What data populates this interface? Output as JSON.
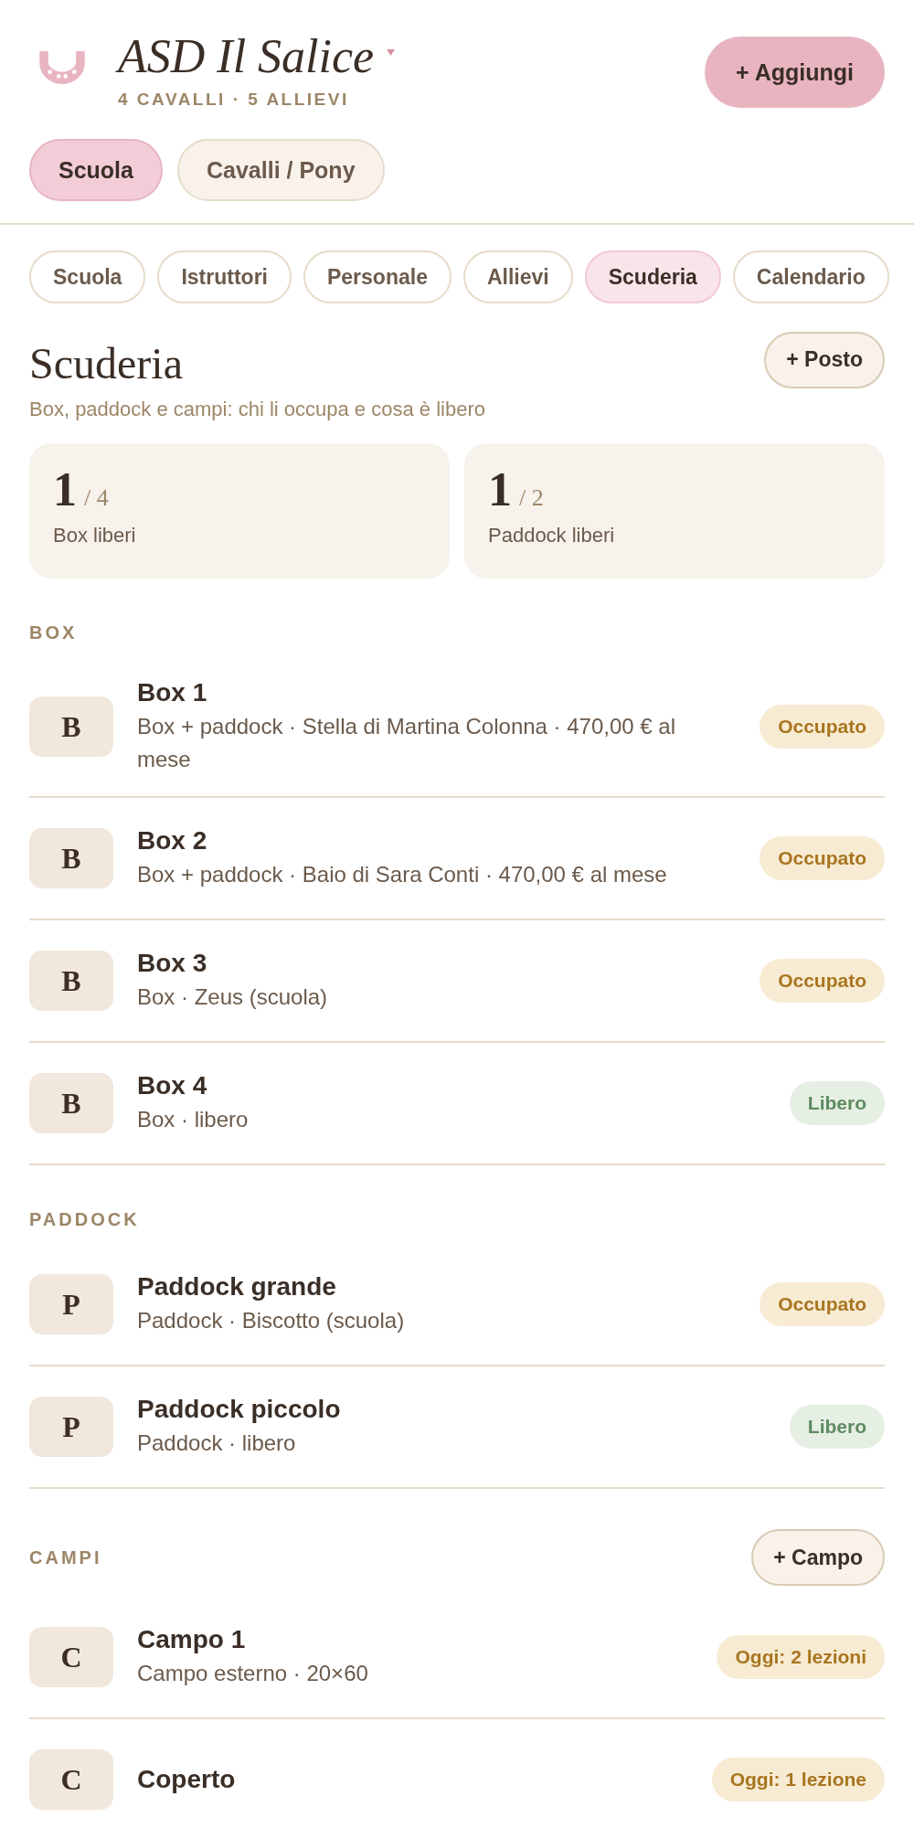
{
  "header": {
    "title": "ASD Il Salice",
    "subtitle": "4 CAVALLI · 5 ALLIEVI",
    "add_button": "+ Aggiungi"
  },
  "mode_tabs": [
    {
      "label": "Scuola",
      "selected": true
    },
    {
      "label": "Cavalli / Pony",
      "selected": false
    }
  ],
  "section_tabs": [
    {
      "label": "Scuola",
      "selected": false
    },
    {
      "label": "Istruttori",
      "selected": false
    },
    {
      "label": "Personale",
      "selected": false
    },
    {
      "label": "Allievi",
      "selected": false
    },
    {
      "label": "Scuderia",
      "selected": true
    },
    {
      "label": "Calendario",
      "selected": false
    }
  ],
  "page": {
    "title": "Scuderia",
    "subtitle": "Box, paddock e campi: chi li occupa e cosa è libero",
    "add_button": "+ Posto"
  },
  "stats": [
    {
      "value": "1",
      "total": "/ 4",
      "label": "Box liberi"
    },
    {
      "value": "1",
      "total": "/ 2",
      "label": "Paddock liberi"
    }
  ],
  "groups": [
    {
      "title": "BOX",
      "items": [
        {
          "initial": "B",
          "name": "Box 1",
          "detail": "Box + paddock · Stella di Martina Colonna · 470,00 € al mese",
          "badge": "Occupato",
          "kind": "occupied"
        },
        {
          "initial": "B",
          "name": "Box 2",
          "detail": "Box + paddock · Baio di Sara Conti · 470,00 € al mese",
          "badge": "Occupato",
          "kind": "occupied"
        },
        {
          "initial": "B",
          "name": "Box 3",
          "detail": "Box · Zeus (scuola)",
          "badge": "Occupato",
          "kind": "occupied"
        },
        {
          "initial": "B",
          "name": "Box 4",
          "detail": "Box · libero",
          "badge": "Libero",
          "kind": "free"
        }
      ]
    },
    {
      "title": "PADDOCK",
      "items": [
        {
          "initial": "P",
          "name": "Paddock grande",
          "detail": "Paddock · Biscotto (scuola)",
          "badge": "Occupato",
          "kind": "occupied"
        },
        {
          "initial": "P",
          "name": "Paddock piccolo",
          "detail": "Paddock · libero",
          "badge": "Libero",
          "kind": "free"
        }
      ]
    },
    {
      "title": "CAMPI",
      "add_button": "+ Campo",
      "items": [
        {
          "initial": "C",
          "name": "Campo 1",
          "detail": "Campo esterno · 20×60",
          "badge": "Oggi: 2 lezioni",
          "kind": "occupied"
        },
        {
          "initial": "C",
          "name": "Coperto",
          "badge": "Oggi: 1 lezione",
          "kind": "occupied"
        }
      ]
    }
  ]
}
